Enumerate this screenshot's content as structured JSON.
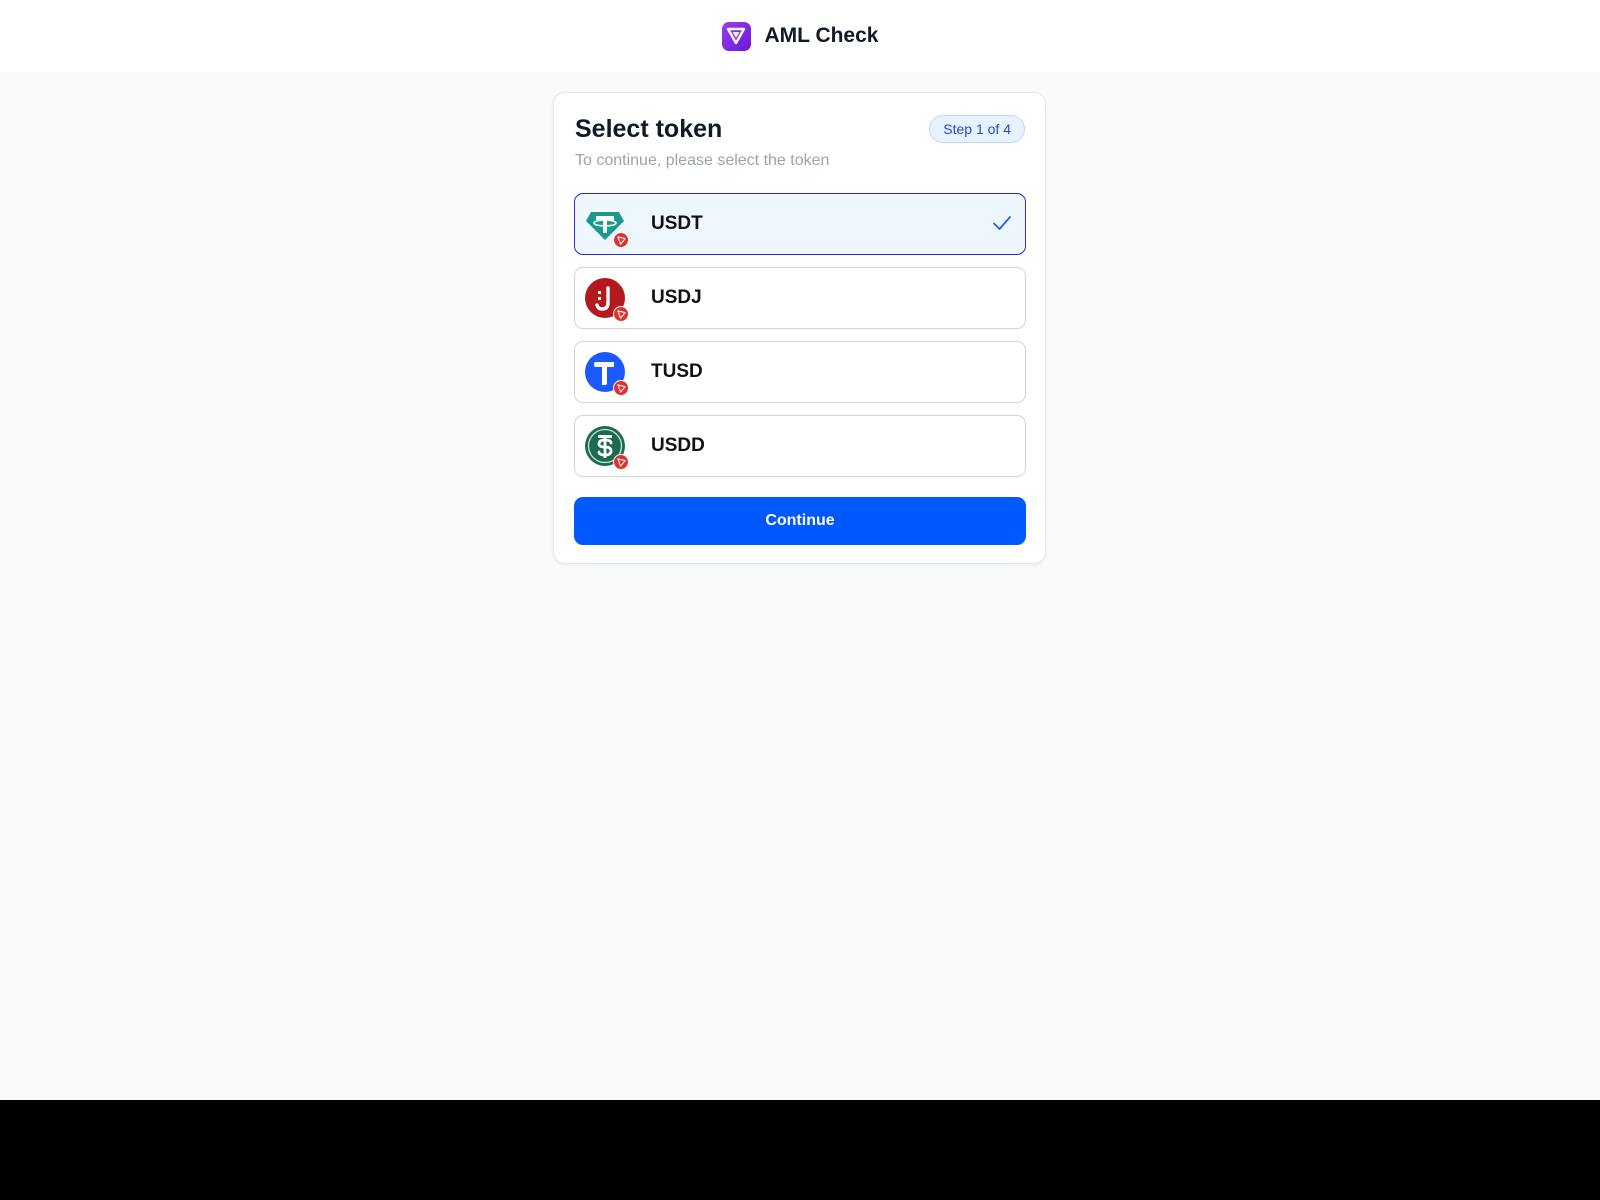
{
  "header": {
    "title": "AML Check",
    "logo_icon": "aml-logo-icon"
  },
  "card": {
    "title": "Select token",
    "subtitle": "To continue, please select the token",
    "step": "Step 1 of 4"
  },
  "tokens": [
    {
      "label": "USDT",
      "icon": "tether-icon",
      "selected": true
    },
    {
      "label": "USDJ",
      "icon": "usdj-icon",
      "selected": false
    },
    {
      "label": "TUSD",
      "icon": "trueusd-icon",
      "selected": false
    },
    {
      "label": "USDD",
      "icon": "usdd-icon",
      "selected": false
    }
  ],
  "actions": {
    "continue_label": "Continue"
  },
  "colors": {
    "primary": "#0058ff",
    "selected_border": "#2b2bcf",
    "selected_bg": "#eef6fe",
    "brand": "#7b2be6",
    "network_badge": "#e0322f"
  }
}
